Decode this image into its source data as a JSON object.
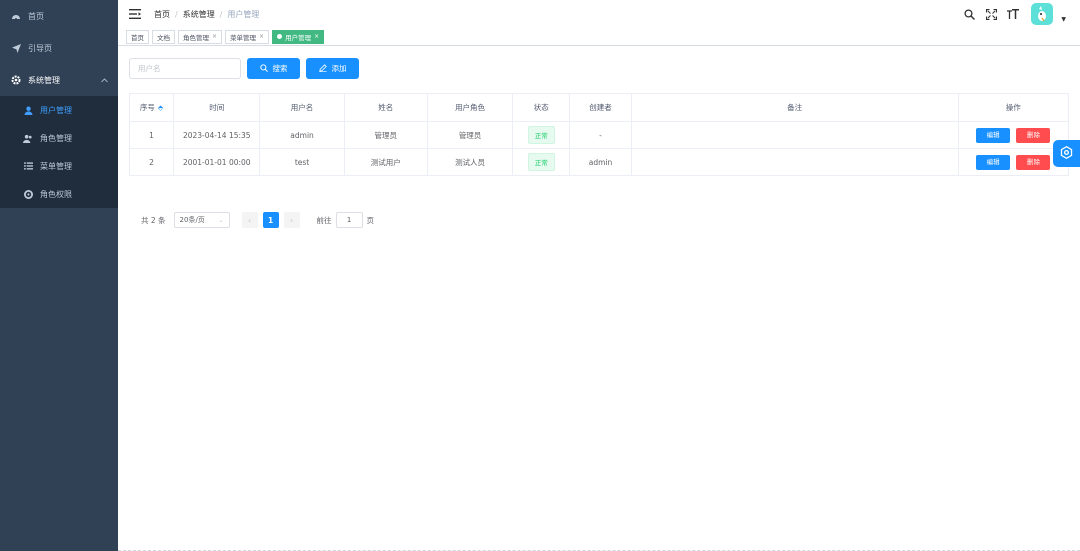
{
  "colors": {
    "sidebar_bg": "#304156",
    "accent": "#1890ff",
    "tag_active": "#42b983",
    "danger": "#ff4d4f",
    "success": "#13ce66"
  },
  "sidebar": {
    "items": [
      {
        "label": "首页",
        "icon": "dashboard-icon"
      },
      {
        "label": "引导页",
        "icon": "paper-plane-icon"
      },
      {
        "label": "系统管理",
        "icon": "gear-icon",
        "expanded": true,
        "children": [
          {
            "label": "用户管理",
            "icon": "user-icon",
            "active": true
          },
          {
            "label": "角色管理",
            "icon": "peoples-icon"
          },
          {
            "label": "菜单管理",
            "icon": "list-icon"
          },
          {
            "label": "角色权限",
            "icon": "lock-icon"
          }
        ]
      }
    ]
  },
  "header": {
    "breadcrumb": [
      "首页",
      "系统管理",
      "用户管理"
    ],
    "breadcrumb_sep": "/"
  },
  "tags": [
    {
      "label": "首页",
      "closable": false
    },
    {
      "label": "文档",
      "closable": false
    },
    {
      "label": "角色管理",
      "closable": true
    },
    {
      "label": "菜单管理",
      "closable": true
    },
    {
      "label": "用户管理",
      "closable": true,
      "active": true
    }
  ],
  "search": {
    "username_placeholder": "用户名",
    "search_label": "搜索",
    "add_label": "添加"
  },
  "table": {
    "columns": [
      "序号",
      "时间",
      "用户名",
      "姓名",
      "用户角色",
      "状态",
      "创建者",
      "备注",
      "操作"
    ],
    "rows": [
      {
        "index": "1",
        "time": "2023-04-14 15:35",
        "username": "admin",
        "name": "管理员",
        "role": "管理员",
        "status": "正常",
        "creator": "-",
        "remark": ""
      },
      {
        "index": "2",
        "time": "2001-01-01 00:00",
        "username": "test",
        "name": "测试用户",
        "role": "测试人员",
        "status": "正常",
        "creator": "admin",
        "remark": ""
      }
    ],
    "edit_label": "编辑",
    "delete_label": "删除"
  },
  "pagination": {
    "total_text": "共 2 条",
    "page_size": "20条/页",
    "current_page": "1",
    "goto_prefix": "前往",
    "goto_value": "1",
    "goto_suffix": "页"
  }
}
